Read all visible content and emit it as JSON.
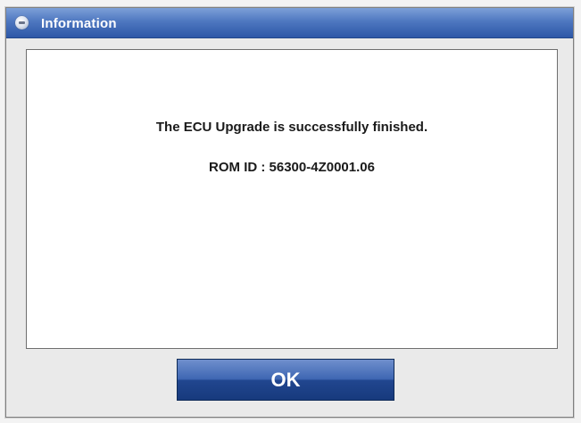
{
  "dialog": {
    "title": "Information",
    "icon": "info-disc-icon"
  },
  "message": {
    "main": "The ECU Upgrade is successfully finished.",
    "rom_id": "ROM ID : 56300-4Z0001.06"
  },
  "actions": {
    "ok_label": "OK"
  },
  "colors": {
    "title_bar": "#2d58a7",
    "ok_button": "#21468f",
    "panel_bg": "#ffffff"
  }
}
